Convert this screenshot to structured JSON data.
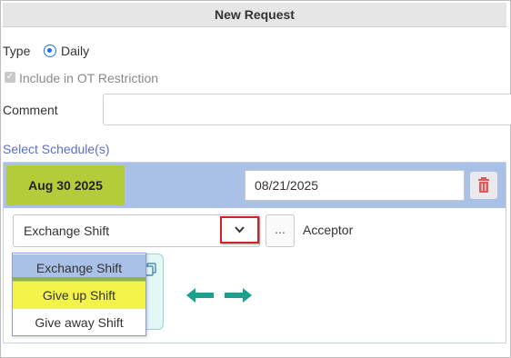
{
  "dialog": {
    "title": "New Request"
  },
  "form": {
    "type_label": "Type",
    "type_option": "Daily",
    "include_ot_label": "Include in OT Restriction",
    "comment_label": "Comment",
    "comment_value": ""
  },
  "schedule": {
    "section_label": "Select Schedule(s)",
    "date_label": "Aug 30 2025",
    "date_input_value": "08/21/2025",
    "shift_select_value": "Exchange Shift",
    "more_button_label": "...",
    "acceptor_label": "Acceptor"
  },
  "dropdown": {
    "options": [
      "Exchange Shift",
      "Give up Shift",
      "Give away Shift"
    ],
    "selected": "Exchange Shift"
  },
  "colors": {
    "accent": "#1a73e8",
    "header_bg": "#a9c1e6",
    "date_badge": "#b5cc3a",
    "highlight_yellow": "#f3f34a",
    "arrow_teal": "#1aa08f",
    "trash_red": "#e05a5a"
  },
  "icons": {
    "trash": "trash-icon",
    "chevron": "chevron-down-icon",
    "copy": "copy-icon",
    "arrow_left": "arrow-left-icon",
    "arrow_right": "arrow-right-icon"
  }
}
